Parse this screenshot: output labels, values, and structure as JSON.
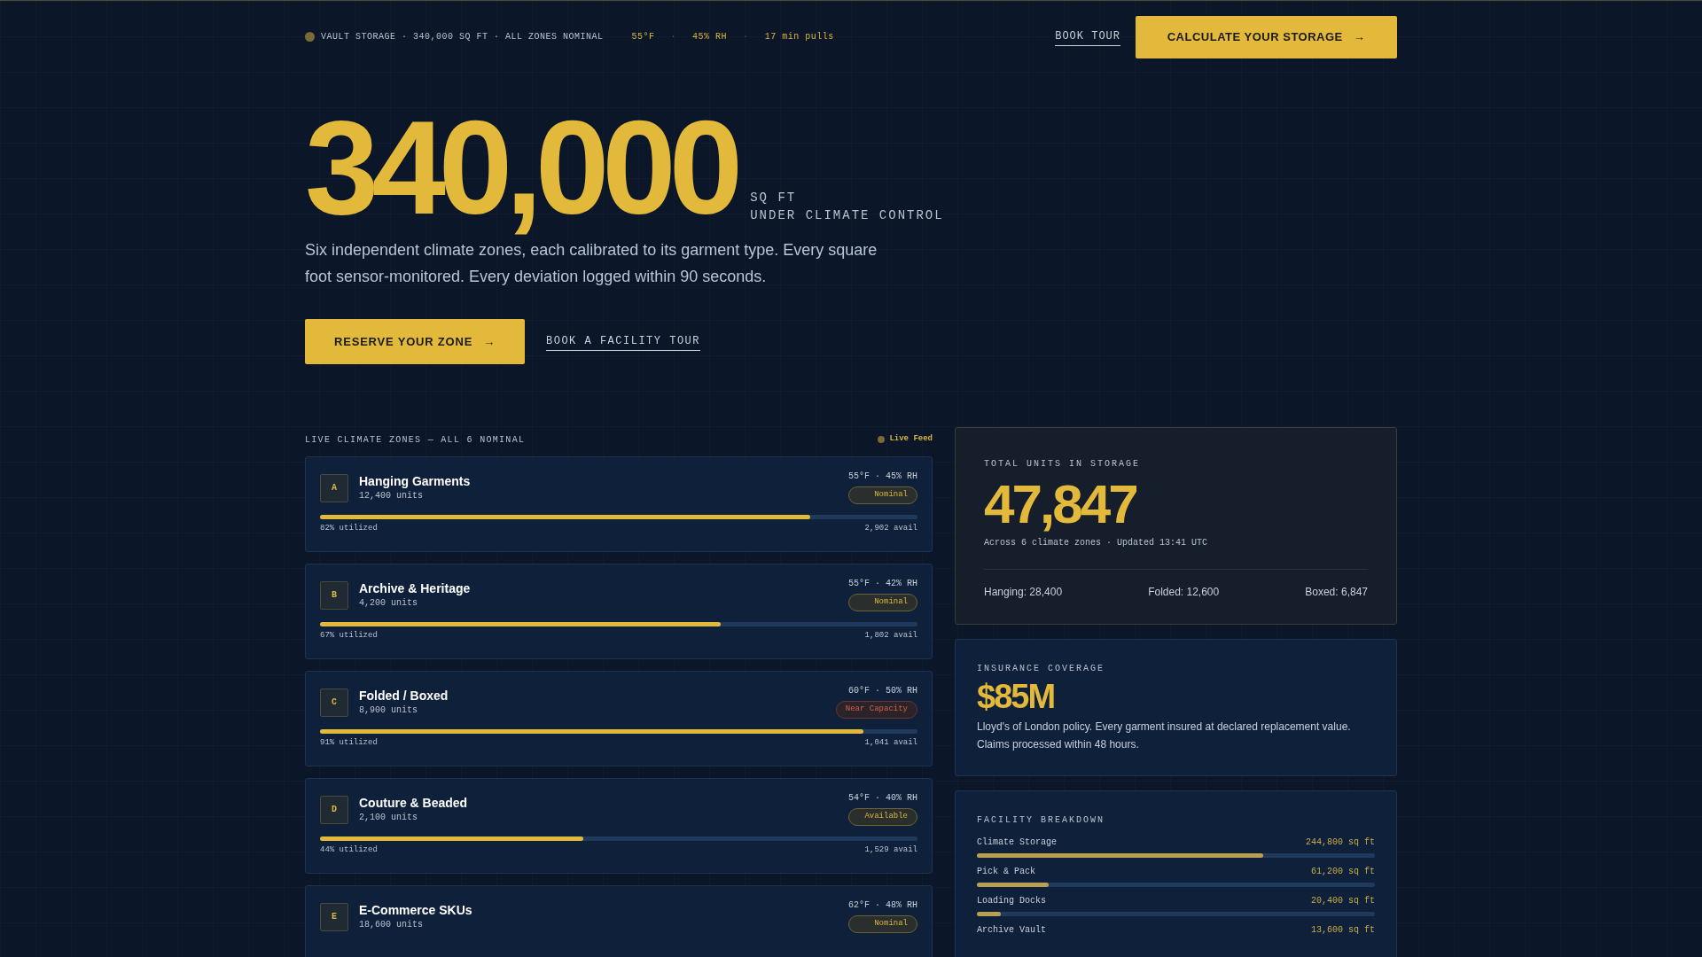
{
  "top_bar": {
    "status": "VAULT STORAGE · 340,000 SQ FT · ALL ZONES NOMINAL",
    "readings": [
      "55°F",
      "45% RH",
      "17 min pulls"
    ],
    "separator": "·",
    "book_tour": "BOOK TOUR",
    "cta": "CALCULATE YOUR STORAGE",
    "cta_arrow": "→"
  },
  "hero": {
    "figure": "340,000",
    "unit": "SQ FT",
    "unit_caption": "UNDER CLIMATE CONTROL",
    "lead": "Six independent climate zones, each calibrated to its garment type. Every square foot sensor-monitored. Every deviation logged within 90 seconds.",
    "primary": "RESERVE YOUR ZONE",
    "primary_arrow": "→",
    "secondary": "BOOK A FACILITY TOUR"
  },
  "zones": {
    "heading": "LIVE CLIMATE ZONES — ALL 6 NOMINAL",
    "live": "Live Feed",
    "items": [
      {
        "letter": "A",
        "name": "Hanging Garments",
        "units": "12,400 units",
        "climate": "55°F · 45% RH",
        "status": "Nominal",
        "kind": "nominal",
        "level": 0.82,
        "utilized": "82% utilized",
        "avail": "2,902 avail"
      },
      {
        "letter": "B",
        "name": "Archive & Heritage",
        "units": "4,200 units",
        "climate": "55°F · 42% RH",
        "status": "Nominal",
        "kind": "nominal",
        "level": 0.67,
        "utilized": "67% utilized",
        "avail": "1,802 avail"
      },
      {
        "letter": "C",
        "name": "Folded / Boxed",
        "units": "8,900 units",
        "climate": "60°F · 50% RH",
        "status": "Near Capacity",
        "kind": "warning",
        "level": 0.91,
        "utilized": "91% utilized",
        "avail": "1,041 avail"
      },
      {
        "letter": "D",
        "name": "Couture & Beaded",
        "units": "2,100 units",
        "climate": "54°F · 40% RH",
        "status": "Available",
        "kind": "nominal",
        "level": 0.44,
        "utilized": "44% utilized",
        "avail": "1,529 avail"
      },
      {
        "letter": "E",
        "name": "E-Commerce SKUs",
        "units": "18,600 units",
        "climate": "62°F · 48% RH",
        "status": "Nominal",
        "kind": "nominal"
      }
    ]
  },
  "total_units": {
    "label": "TOTAL UNITS IN STORAGE",
    "value": "47,847",
    "caption": "Across 6 climate zones · Updated 13:41 UTC",
    "split": [
      "Hanging: 28,400",
      "Folded: 12,600",
      "Boxed: 6,847"
    ]
  },
  "insurance": {
    "label": "INSURANCE COVERAGE",
    "value": "$85M",
    "text": "Lloyd's of London policy. Every garment insured at declared replacement value. Claims processed within 48 hours."
  },
  "facility": {
    "label": "FACILITY BREAKDOWN",
    "items": [
      {
        "name": "Climate Storage",
        "area": "244,800 sq ft",
        "level": 0.72
      },
      {
        "name": "Pick & Pack",
        "area": "61,200 sq ft",
        "level": 0.18
      },
      {
        "name": "Loading Docks",
        "area": "20,400 sq ft",
        "level": 0.06
      },
      {
        "name": "Archive Vault",
        "area": "13,600 sq ft"
      }
    ]
  }
}
